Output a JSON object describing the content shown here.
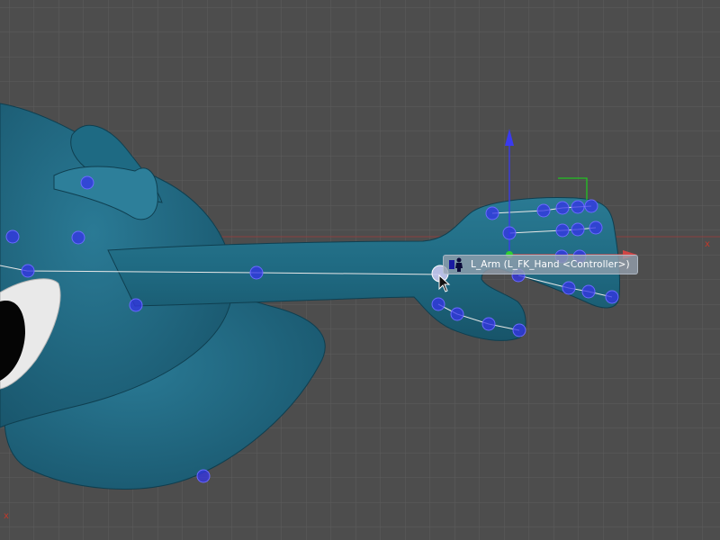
{
  "viewport": {
    "background_color": "#4d4d4d",
    "grid_color": "#5c5c5c",
    "mesh_color": "#21677f",
    "mesh_dark_color": "#164c60",
    "handle_color": "#3b3bf2",
    "skeleton_line_color": "#e8e8e8",
    "axis_y_color": "#3a3af0",
    "axis_x_color": "#c0392b",
    "axis_z_color": "#22c322"
  },
  "tooltip": {
    "icon": "controller-figure-icon",
    "text": "L_Arm (L_FK_Hand <Controller>)"
  },
  "axis_labels": {
    "x_right": "x",
    "x_corner": "x"
  },
  "cursor": {
    "icon": "arrow-cursor-icon"
  }
}
